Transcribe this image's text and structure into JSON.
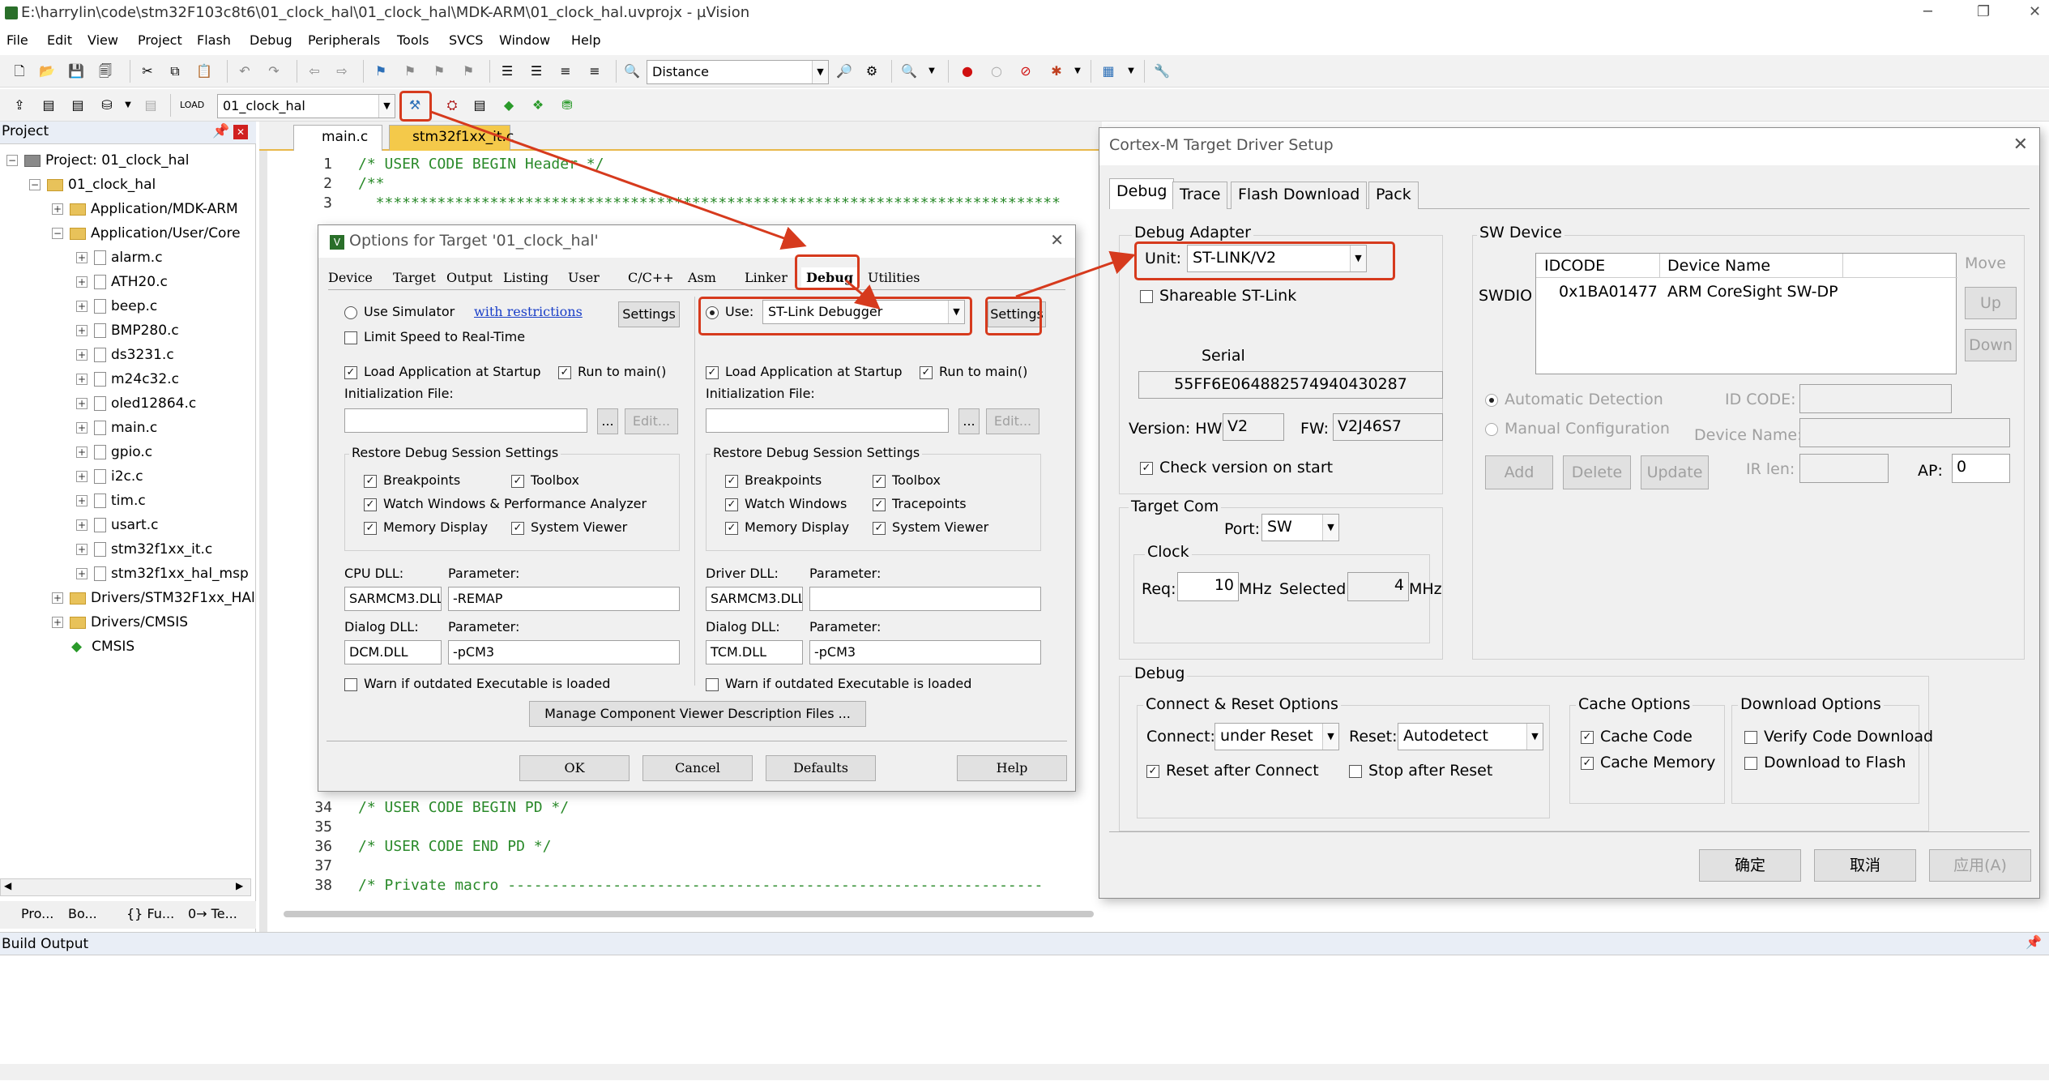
{
  "title_bar": {
    "title": "E:\\harrylin\\code\\stm32F103c8t6\\01_clock_hal\\01_clock_hal\\MDK-ARM\\01_clock_hal.uvprojx - µVision"
  },
  "menu": [
    "File",
    "Edit",
    "View",
    "Project",
    "Flash",
    "Debug",
    "Peripherals",
    "Tools",
    "SVCS",
    "Window",
    "Help"
  ],
  "toolbar": {
    "find_combo": "Distance",
    "target_combo": "01_clock_hal"
  },
  "editor_tabs": [
    "main.c",
    "stm32f1xx_it.c"
  ],
  "project": {
    "header": "Project",
    "tree": [
      "Project: 01_clock_hal",
      "01_clock_hal",
      "Application/MDK-ARM",
      "Application/User/Core",
      "alarm.c",
      "ATH20.c",
      "beep.c",
      "BMP280.c",
      "ds3231.c",
      "m24c32.c",
      "oled12864.c",
      "main.c",
      "gpio.c",
      "i2c.c",
      "tim.c",
      "usart.c",
      "stm32f1xx_it.c",
      "stm32f1xx_hal_msp",
      "Drivers/STM32F1xx_HAl",
      "Drivers/CMSIS",
      "CMSIS"
    ],
    "bottom_tabs": [
      "Pro...",
      "Bo...",
      "{} Fu...",
      "0→ Te..."
    ]
  },
  "editor": {
    "lines": [
      {
        "n": "1",
        "t": "/* USER CODE BEGIN Header */"
      },
      {
        "n": "2",
        "t": "/**"
      },
      {
        "n": "3",
        "t": "  ******************************************************************************"
      },
      {
        "n": "34",
        "t": "/* USER CODE BEGIN PD */"
      },
      {
        "n": "35",
        "t": ""
      },
      {
        "n": "36",
        "t": "/* USER CODE END PD */"
      },
      {
        "n": "37",
        "t": ""
      },
      {
        "n": "38",
        "t": "/* Private macro -------------------------------------------------------------"
      }
    ]
  },
  "options": {
    "title": "Options for Target '01_clock_hal'",
    "tabs": [
      "Device",
      "Target",
      "Output",
      "Listing",
      "User",
      "C/C++",
      "Asm",
      "Linker",
      "Debug",
      "Utilities"
    ],
    "left": {
      "use_sim": "Use Simulator",
      "restrictions": "with restrictions",
      "settings": "Settings",
      "limit": "Limit Speed to Real-Time",
      "load_app": "Load Application at Startup",
      "run_main": "Run to main()",
      "init_file": "Initialization File:",
      "edit": "Edit...",
      "browse": "...",
      "restore": "Restore Debug Session Settings",
      "bp": "Breakpoints",
      "toolbox": "Toolbox",
      "watch": "Watch Windows & Performance Analyzer",
      "memory": "Memory Display",
      "sysviewer": "System Viewer",
      "dll_label": "CPU DLL:",
      "param": "Parameter:",
      "dll": "SARMCM3.DLL",
      "dll_param": "-REMAP",
      "dialog_dll": "Dialog DLL:",
      "dlg_dll": "DCM.DLL",
      "dlg_param": "-pCM3",
      "warn": "Warn if outdated Executable is loaded"
    },
    "right": {
      "use": "Use:",
      "debugger": "ST-Link Debugger",
      "settings": "Settings",
      "load_app": "Load Application at Startup",
      "run_main": "Run to main()",
      "init_file": "Initialization File:",
      "edit": "Edit...",
      "browse": "...",
      "restore": "Restore Debug Session Settings",
      "bp": "Breakpoints",
      "toolbox": "Toolbox",
      "watch": "Watch Windows",
      "trace": "Tracepoints",
      "memory": "Memory Display",
      "sysviewer": "System Viewer",
      "dll_label": "Driver DLL:",
      "param": "Parameter:",
      "dll": "SARMCM3.DLL",
      "dll_param": "",
      "dialog_dll": "Dialog DLL:",
      "dlg_dll": "TCM.DLL",
      "dlg_param": "-pCM3",
      "warn": "Warn if outdated Executable is loaded"
    },
    "manage": "Manage Component Viewer Description Files ...",
    "buttons": [
      "OK",
      "Cancel",
      "Defaults",
      "Help"
    ]
  },
  "cortex": {
    "title": "Cortex-M Target Driver Setup",
    "tabs": [
      "Debug",
      "Trace",
      "Flash Download",
      "Pack"
    ],
    "adapter": {
      "label": "Debug Adapter",
      "unit_label": "Unit:",
      "unit": "ST-LINK/V2",
      "shareable": "Shareable ST-Link",
      "serial_label": "Serial",
      "serial": "55FF6E064882574940430287",
      "version": "Version: HW:",
      "hw": "V2",
      "fw_label": "FW:",
      "fw": "V2J46S7",
      "check": "Check version on start"
    },
    "swdev": {
      "label": "SW Device",
      "swdio": "SWDIO",
      "col1": "IDCODE",
      "col2": "Device Name",
      "idcode": "0x1BA01477",
      "devname": "ARM CoreSight SW-DP",
      "move": "Move",
      "up": "Up",
      "down": "Down",
      "auto": "Automatic Detection",
      "manual": "Manual Configuration",
      "idcode_lbl": "ID CODE:",
      "devname_lbl": "Device Name:",
      "add": "Add",
      "delete": "Delete",
      "update": "Update",
      "irlen": "IR len:",
      "ap": "AP:",
      "ap_val": "0"
    },
    "targetcom": {
      "label": "Target Com",
      "port_label": "Port:",
      "port": "SW",
      "clock": "Clock",
      "req": "Req:",
      "req_val": "10",
      "mhz": "MHz",
      "selected": "Selected:",
      "sel_val": "4"
    },
    "debug": {
      "label": "Debug",
      "connect_reset": "Connect & Reset Options",
      "connect_lbl": "Connect:",
      "connect": "under Reset",
      "reset_lbl": "Reset:",
      "reset": "Autodetect",
      "reset_after": "Reset after Connect",
      "stop_after": "Stop after Reset",
      "cache": "Cache Options",
      "cache_code": "Cache Code",
      "cache_mem": "Cache Memory",
      "download": "Download Options",
      "verify": "Verify Code Download",
      "dl_flash": "Download to Flash"
    },
    "buttons": [
      "确定",
      "取消",
      "应用(A)"
    ]
  },
  "build_output": "Build Output"
}
